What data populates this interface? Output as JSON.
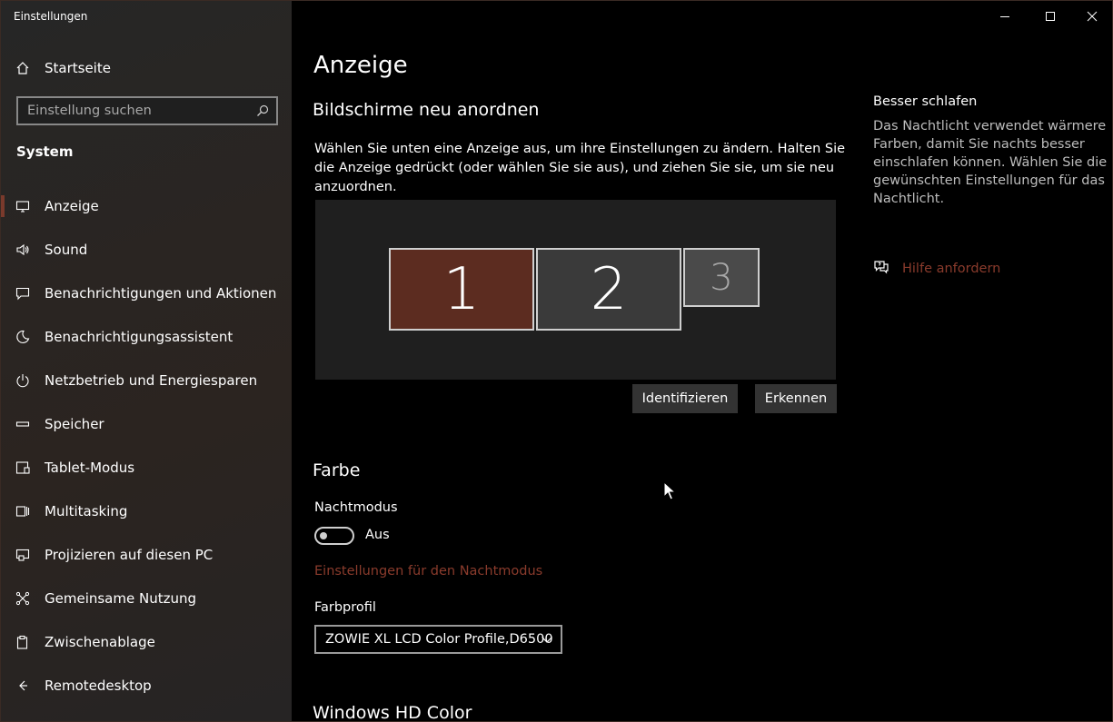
{
  "app": {
    "title": "Einstellungen"
  },
  "sidebar": {
    "home_label": "Startseite",
    "search_placeholder": "Einstellung suchen",
    "section": "System",
    "items": [
      {
        "label": "Anzeige",
        "icon": "monitor-icon",
        "active": true
      },
      {
        "label": "Sound",
        "icon": "speaker-icon"
      },
      {
        "label": "Benachrichtigungen und Aktionen",
        "icon": "message-icon"
      },
      {
        "label": "Benachrichtigungsassistent",
        "icon": "moon-icon"
      },
      {
        "label": "Netzbetrieb und Energiesparen",
        "icon": "power-icon"
      },
      {
        "label": "Speicher",
        "icon": "storage-icon"
      },
      {
        "label": "Tablet-Modus",
        "icon": "tablet-icon"
      },
      {
        "label": "Multitasking",
        "icon": "multitasking-icon"
      },
      {
        "label": "Projizieren auf diesen PC",
        "icon": "project-icon"
      },
      {
        "label": "Gemeinsame Nutzung",
        "icon": "share-icon"
      },
      {
        "label": "Zwischenablage",
        "icon": "clipboard-icon"
      },
      {
        "label": "Remotedesktop",
        "icon": "remote-desktop-icon"
      }
    ]
  },
  "main": {
    "title": "Anzeige",
    "arrange": {
      "heading": "Bildschirme neu anordnen",
      "description": "Wählen Sie unten eine Anzeige aus, um ihre Einstellungen zu ändern. Halten Sie die Anzeige gedrückt (oder wählen Sie sie aus), und ziehen Sie sie, um sie neu anzuordnen.",
      "monitors": [
        "1",
        "2",
        "3"
      ],
      "selected_color": "#5c2c20",
      "identify_label": "Identifizieren",
      "detect_label": "Erkennen"
    },
    "color": {
      "heading": "Farbe",
      "night_mode_label": "Nachtmodus",
      "toggle_state": "Aus",
      "night_settings_link": "Einstellungen für den Nachtmodus",
      "profile_label": "Farbprofil",
      "profile_value": "ZOWIE XL LCD Color Profile,D6500"
    },
    "hd_color_heading": "Windows HD Color"
  },
  "aside": {
    "title": "Besser schlafen",
    "text": "Das Nachtlicht verwendet wärmere Farben, damit Sie nachts besser einschlafen können. Wählen Sie die gewünschten Einstellungen für das Nachtlicht.",
    "help_link": "Hilfe anfordern"
  },
  "colors": {
    "accent_link": "#8a3b2c",
    "sidebar_bg": "#2a2522"
  }
}
